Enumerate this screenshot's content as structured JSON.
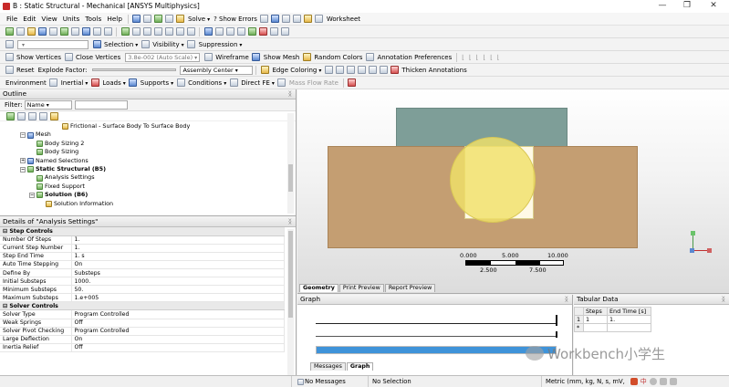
{
  "title": "B : Static Structural - Mechanical [ANSYS Multiphysics]",
  "window_controls": [
    "—",
    "❐",
    "✕"
  ],
  "menu": [
    "File",
    "Edit",
    "View",
    "Units",
    "Tools",
    "Help"
  ],
  "toolbar1": {
    "solve": "Solve",
    "show_errors": "? Show Errors",
    "worksheet": "Worksheet"
  },
  "toolbar3": {
    "selection": "Selection",
    "visibility": "Visibility",
    "suppression": "Suppression"
  },
  "toolbar4": {
    "show_vertices": "Show Vertices",
    "close_vertices": "Close Vertices",
    "close_value": "3.8e-002 (Auto Scale)",
    "wireframe": "Wireframe",
    "show_mesh": "Show Mesh",
    "random_colors": "Random Colors",
    "annotation_prefs": "Annotation Preferences"
  },
  "toolbar5": {
    "reset": "Reset",
    "explode_factor": "Explode Factor:",
    "assembly_center": "Assembly Center",
    "edge_coloring": "Edge Coloring",
    "thicken": "Thicken Annotations"
  },
  "toolbar6": [
    "Environment",
    "Inertial",
    "Loads",
    "Supports",
    "Conditions",
    "Direct FE",
    "Mass Flow Rate"
  ],
  "outline": {
    "title": "Outline",
    "filter_label": "Filter:",
    "filter_value": "Name",
    "nodes": [
      "Frictional - Surface Body To Surface Body",
      "Mesh",
      "Body Sizing 2",
      "Body Sizing",
      "Named Selections",
      "Static Structural (B5)",
      "Analysis Settings",
      "Fixed Support",
      "Solution (B6)",
      "Solution Information"
    ]
  },
  "details": {
    "title": "Details of \"Analysis Settings\"",
    "groups": [
      {
        "name": "Step Controls",
        "rows": [
          [
            "Number Of Steps",
            "1."
          ],
          [
            "Current Step Number",
            "1."
          ],
          [
            "Step End Time",
            "1. s"
          ],
          [
            "Auto Time Stepping",
            "On"
          ],
          [
            "Define By",
            "Substeps"
          ],
          [
            "Initial Substeps",
            "1000."
          ],
          [
            "Minimum Substeps",
            "50."
          ],
          [
            "Maximum Substeps",
            "1.e+005"
          ]
        ]
      },
      {
        "name": "Solver Controls",
        "rows": [
          [
            "Solver Type",
            "Program Controlled"
          ],
          [
            "Weak Springs",
            "Off"
          ],
          [
            "Solver Pivot Checking",
            "Program Controlled"
          ],
          [
            "Large Deflection",
            "On"
          ],
          [
            "Inertia Relief",
            "Off"
          ]
        ]
      }
    ]
  },
  "viewport": {
    "scale": {
      "top_labels": [
        "0.000",
        "5.000",
        "10.000 (mm)"
      ],
      "bottom_labels": [
        "2.500",
        "7.500"
      ]
    },
    "tabs": [
      "Geometry",
      "Print Preview",
      "Report Preview"
    ],
    "colors": {
      "bg_top": "#ffffff",
      "bg_bottom": "#dcdcdc",
      "block": "#7e9e98",
      "body": "#c49e72",
      "circle": "#efe06a"
    }
  },
  "graph": {
    "title": "Graph",
    "tabs": [
      "Messages",
      "Graph"
    ],
    "progress": 1.0
  },
  "tabular": {
    "title": "Tabular Data",
    "headers": [
      "Steps",
      "End Time [s]"
    ],
    "row": [
      "1",
      "1",
      "1."
    ],
    "new_row_marker": "*"
  },
  "status": {
    "messages": "No Messages",
    "selection": "No Selection",
    "units": "Metric (mm, kg, N, s, mV,"
  },
  "watermark": "Workbench小学生"
}
